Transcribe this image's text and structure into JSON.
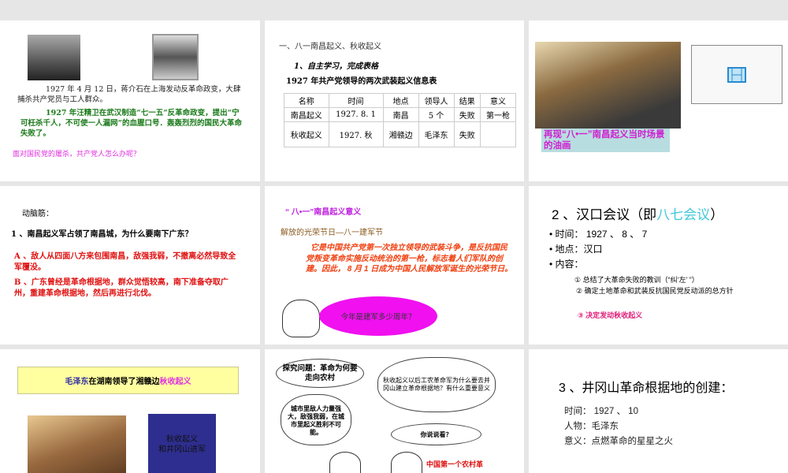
{
  "slide1": {
    "p1": "1927 年 4 月 12 日，蒋介石在上海发动反革命政变，大肆捕杀共产党员与工人群众。",
    "p2": "1927 年汪精卫在武汉制造“七一五”反革命政变，提出“宁可枉杀千人，不可使一人漏网”的血腥口号．轰轰烈烈的国民大革命失败了。",
    "p3": "面对国民党的屠杀，共产党人怎么办呢？"
  },
  "slide2": {
    "heading": "一、八一南昌起义、秋收起义",
    "sub": "1、自主学习，完成表格",
    "table_title": "1927 年共产党领导的两次武装起义信息表",
    "headers": [
      "名称",
      "时间",
      "地点",
      "领导人",
      "结果",
      "意义"
    ],
    "rows": [
      [
        "南昌起义",
        "1927. 8. 1",
        "南昌",
        "5 个",
        "失败",
        "第一枪"
      ],
      [
        "秋收起义",
        "1927. 秋",
        "湘赣边",
        "毛泽东",
        "失败",
        ""
      ]
    ]
  },
  "slide3": {
    "caption": "再现“八•一”南昌起义当时场景的油画",
    "video_icon": "film-icon"
  },
  "slide4": {
    "label": "动脑筋：",
    "question": "1 、南昌起义军占领了南昌城，为什么要南下广东？",
    "a": "A 、敌人从四面八方来包围南昌，敌强我弱，不撤离必然导致全军覆没。",
    "b": "B 、广东曾经是革命根据地，群众觉悟较高，南下准备夺取广州，重建革命根据地，然后再进行北伐。"
  },
  "slide5": {
    "title": "“ 八•一”南昌起义意义",
    "subtitle": "解放的光荣节日—八一建军节",
    "body": "它是中国共产党第一次独立领导的武装斗争，是反抗国民党叛变革命实施反动统治的第一枪，标志着人们军队的创建。因此， 8 月 1 日成为中国人民解放军诞生的光荣节日。",
    "bubble": "今年是建军多少周年？"
  },
  "slide6": {
    "title_a": "2 、汉口会议（即",
    "title_b": "八七会议",
    "title_c": "）",
    "items": [
      "时间： 1927 、 8 、 7",
      "地点：汉口",
      "内容："
    ],
    "sub1": "① 总结了大革命失败的教训（“纠‘左’ ”）",
    "sub2": "②  确定土地革命和武装反抗国民党反动派的总方针",
    "sub3": "③  决定发动秋收起义"
  },
  "slide7": {
    "banner_a": "毛泽东",
    "banner_b": "在湖南领导了湘赣边",
    "banner_c": "秋收起义",
    "box": "秋收起义\n和井冈山进军"
  },
  "slide8": {
    "q_title": "探究问题：革命为何要走向农村",
    "cloud1": "秋收起义以后工农革命军为什么要去井冈山建立革命根据地？有什么重要意义",
    "cloud2": "城市里敌人力量强大，敌强我弱，在城市里起义胜利不可能。",
    "cloud3": "你说说看？",
    "burst": "中国第一个农村革"
  },
  "slide9": {
    "title": "3 、井冈山革命根据地的创建：",
    "lines": [
      "时间： 1927 、 10",
      "人物：毛泽东",
      "意义：点燃革命的星星之火"
    ]
  }
}
